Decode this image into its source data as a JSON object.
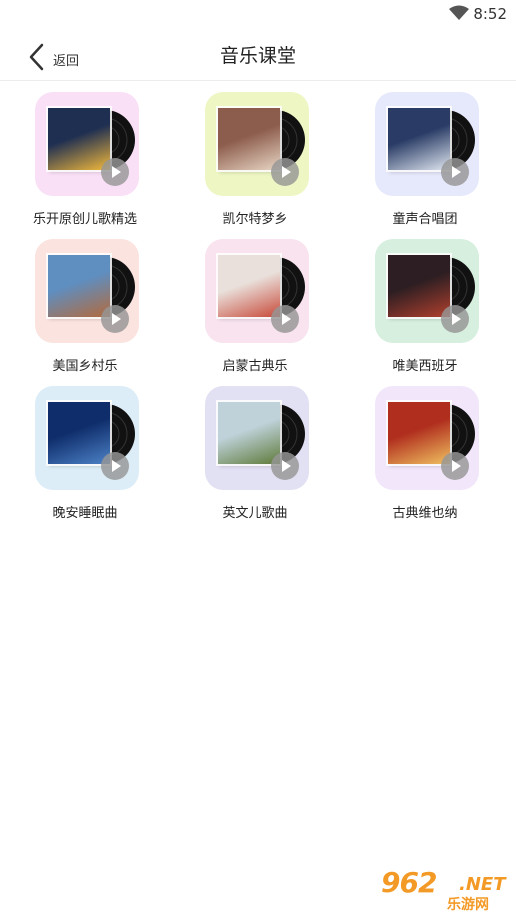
{
  "status_bar": {
    "time": "8:52"
  },
  "header": {
    "back_label": "返回",
    "title": "音乐课堂"
  },
  "items": [
    {
      "label": "乐开原创儿歌精选",
      "card_color": "#f9e0f6",
      "cover_colors": [
        "#1f2f52",
        "#f2b93b"
      ]
    },
    {
      "label": "凯尔特梦乡",
      "card_color": "#eef6c4",
      "cover_colors": [
        "#8c5c4c",
        "#e8d5c4"
      ]
    },
    {
      "label": "童声合唱团",
      "card_color": "#e6e8fb",
      "cover_colors": [
        "#2a3c66",
        "#dfe6f0"
      ]
    },
    {
      "label": "美国乡村乐",
      "card_color": "#fbe3df",
      "cover_colors": [
        "#5f8ec0",
        "#b36a3c"
      ]
    },
    {
      "label": "启蒙古典乐",
      "card_color": "#f8e3ef",
      "cover_colors": [
        "#e9e0db",
        "#c84a3a"
      ]
    },
    {
      "label": "唯美西班牙",
      "card_color": "#d6efdf",
      "cover_colors": [
        "#2c1e22",
        "#b2402e"
      ]
    },
    {
      "label": "晚安睡眠曲",
      "card_color": "#dcedf7",
      "cover_colors": [
        "#0f2d6b",
        "#4c82c7"
      ]
    },
    {
      "label": "英文儿歌曲",
      "card_color": "#e2e0f3",
      "cover_colors": [
        "#bfd2da",
        "#5f7a3a"
      ]
    },
    {
      "label": "古典维也纳",
      "card_color": "#f1e6fa",
      "cover_colors": [
        "#b02e1e",
        "#f0c060"
      ]
    }
  ],
  "watermark": {
    "main": "962",
    "domain": ".NET",
    "sub": "乐游网"
  }
}
